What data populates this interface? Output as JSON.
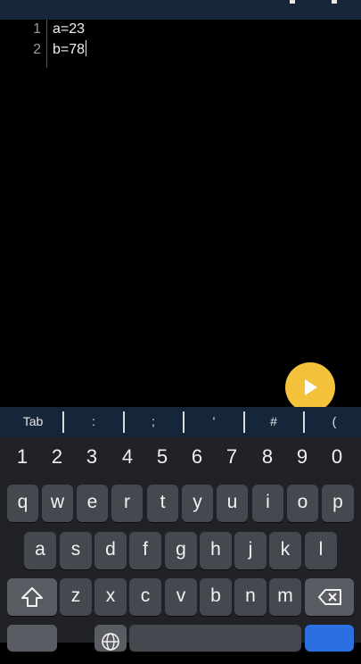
{
  "editor": {
    "lines": [
      {
        "num": "1",
        "code": "a=23"
      },
      {
        "num": "2",
        "code": "b=78"
      }
    ]
  },
  "run_button": {
    "icon": "play-icon",
    "color": "#f3c13a"
  },
  "symbol_bar": [
    "Tab",
    ":",
    ";",
    "'",
    "#",
    "("
  ],
  "keyboard": {
    "digits": [
      "1",
      "2",
      "3",
      "4",
      "5",
      "6",
      "7",
      "8",
      "9",
      "0"
    ],
    "row1": [
      "q",
      "w",
      "e",
      "r",
      "t",
      "y",
      "u",
      "i",
      "o",
      "p"
    ],
    "row2": [
      "a",
      "s",
      "d",
      "f",
      "g",
      "h",
      "j",
      "k",
      "l"
    ],
    "row3": [
      "z",
      "x",
      "c",
      "v",
      "b",
      "n",
      "m"
    ],
    "shift_icon": "shift-arrow-icon",
    "backspace_icon": "backspace-icon",
    "globe_icon": "globe-icon"
  },
  "colors": {
    "background": "#000000",
    "symbol_bar": "#16263a",
    "keyboard": "#202228",
    "key": "#46484f",
    "accent": "#2c6fe0"
  }
}
